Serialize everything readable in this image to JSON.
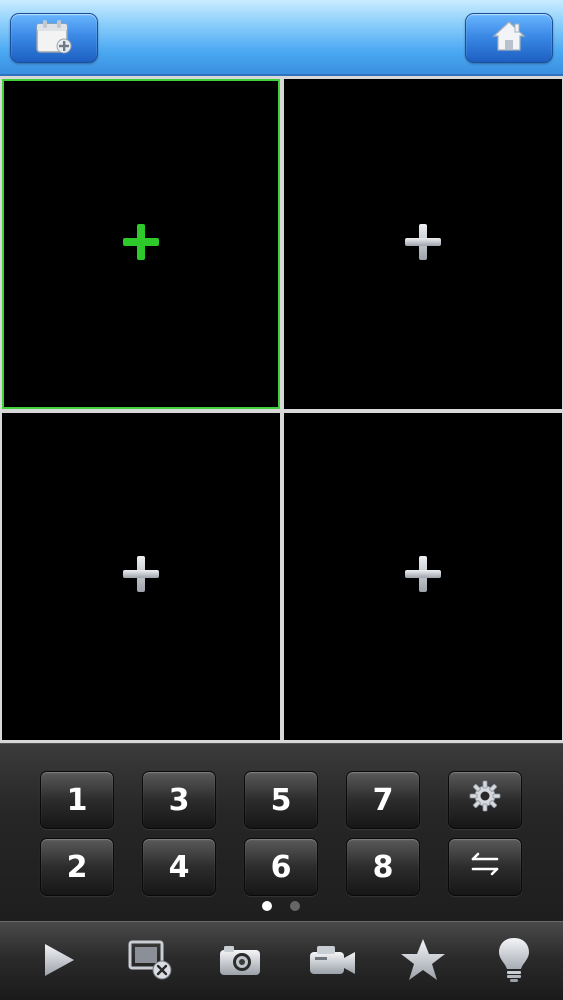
{
  "topbar": {
    "left_button": {
      "icon": "calendar-add-icon"
    },
    "right_button": {
      "icon": "home-icon"
    }
  },
  "video_grid": {
    "cells": [
      {
        "icon": "add-icon",
        "selected": true,
        "icon_color": "#2ec92a"
      },
      {
        "icon": "add-icon",
        "selected": false,
        "icon_color": "#c9cbd0"
      },
      {
        "icon": "add-icon",
        "selected": false,
        "icon_color": "#c9cbd0"
      },
      {
        "icon": "add-icon",
        "selected": false,
        "icon_color": "#c9cbd0"
      }
    ],
    "selected_border_color": "#3fd13a"
  },
  "keypad": {
    "keys": [
      "1",
      "3",
      "5",
      "7",
      "2",
      "4",
      "6",
      "8"
    ],
    "settings_icon": "gear-icon",
    "switch_icon": "swap-arrows-icon",
    "page_indicator": {
      "pages": 2,
      "current": 1
    }
  },
  "toolbar": {
    "items": [
      "play-icon",
      "close-window-icon",
      "camera-icon",
      "video-camera-icon",
      "star-icon",
      "lightbulb-icon"
    ]
  }
}
